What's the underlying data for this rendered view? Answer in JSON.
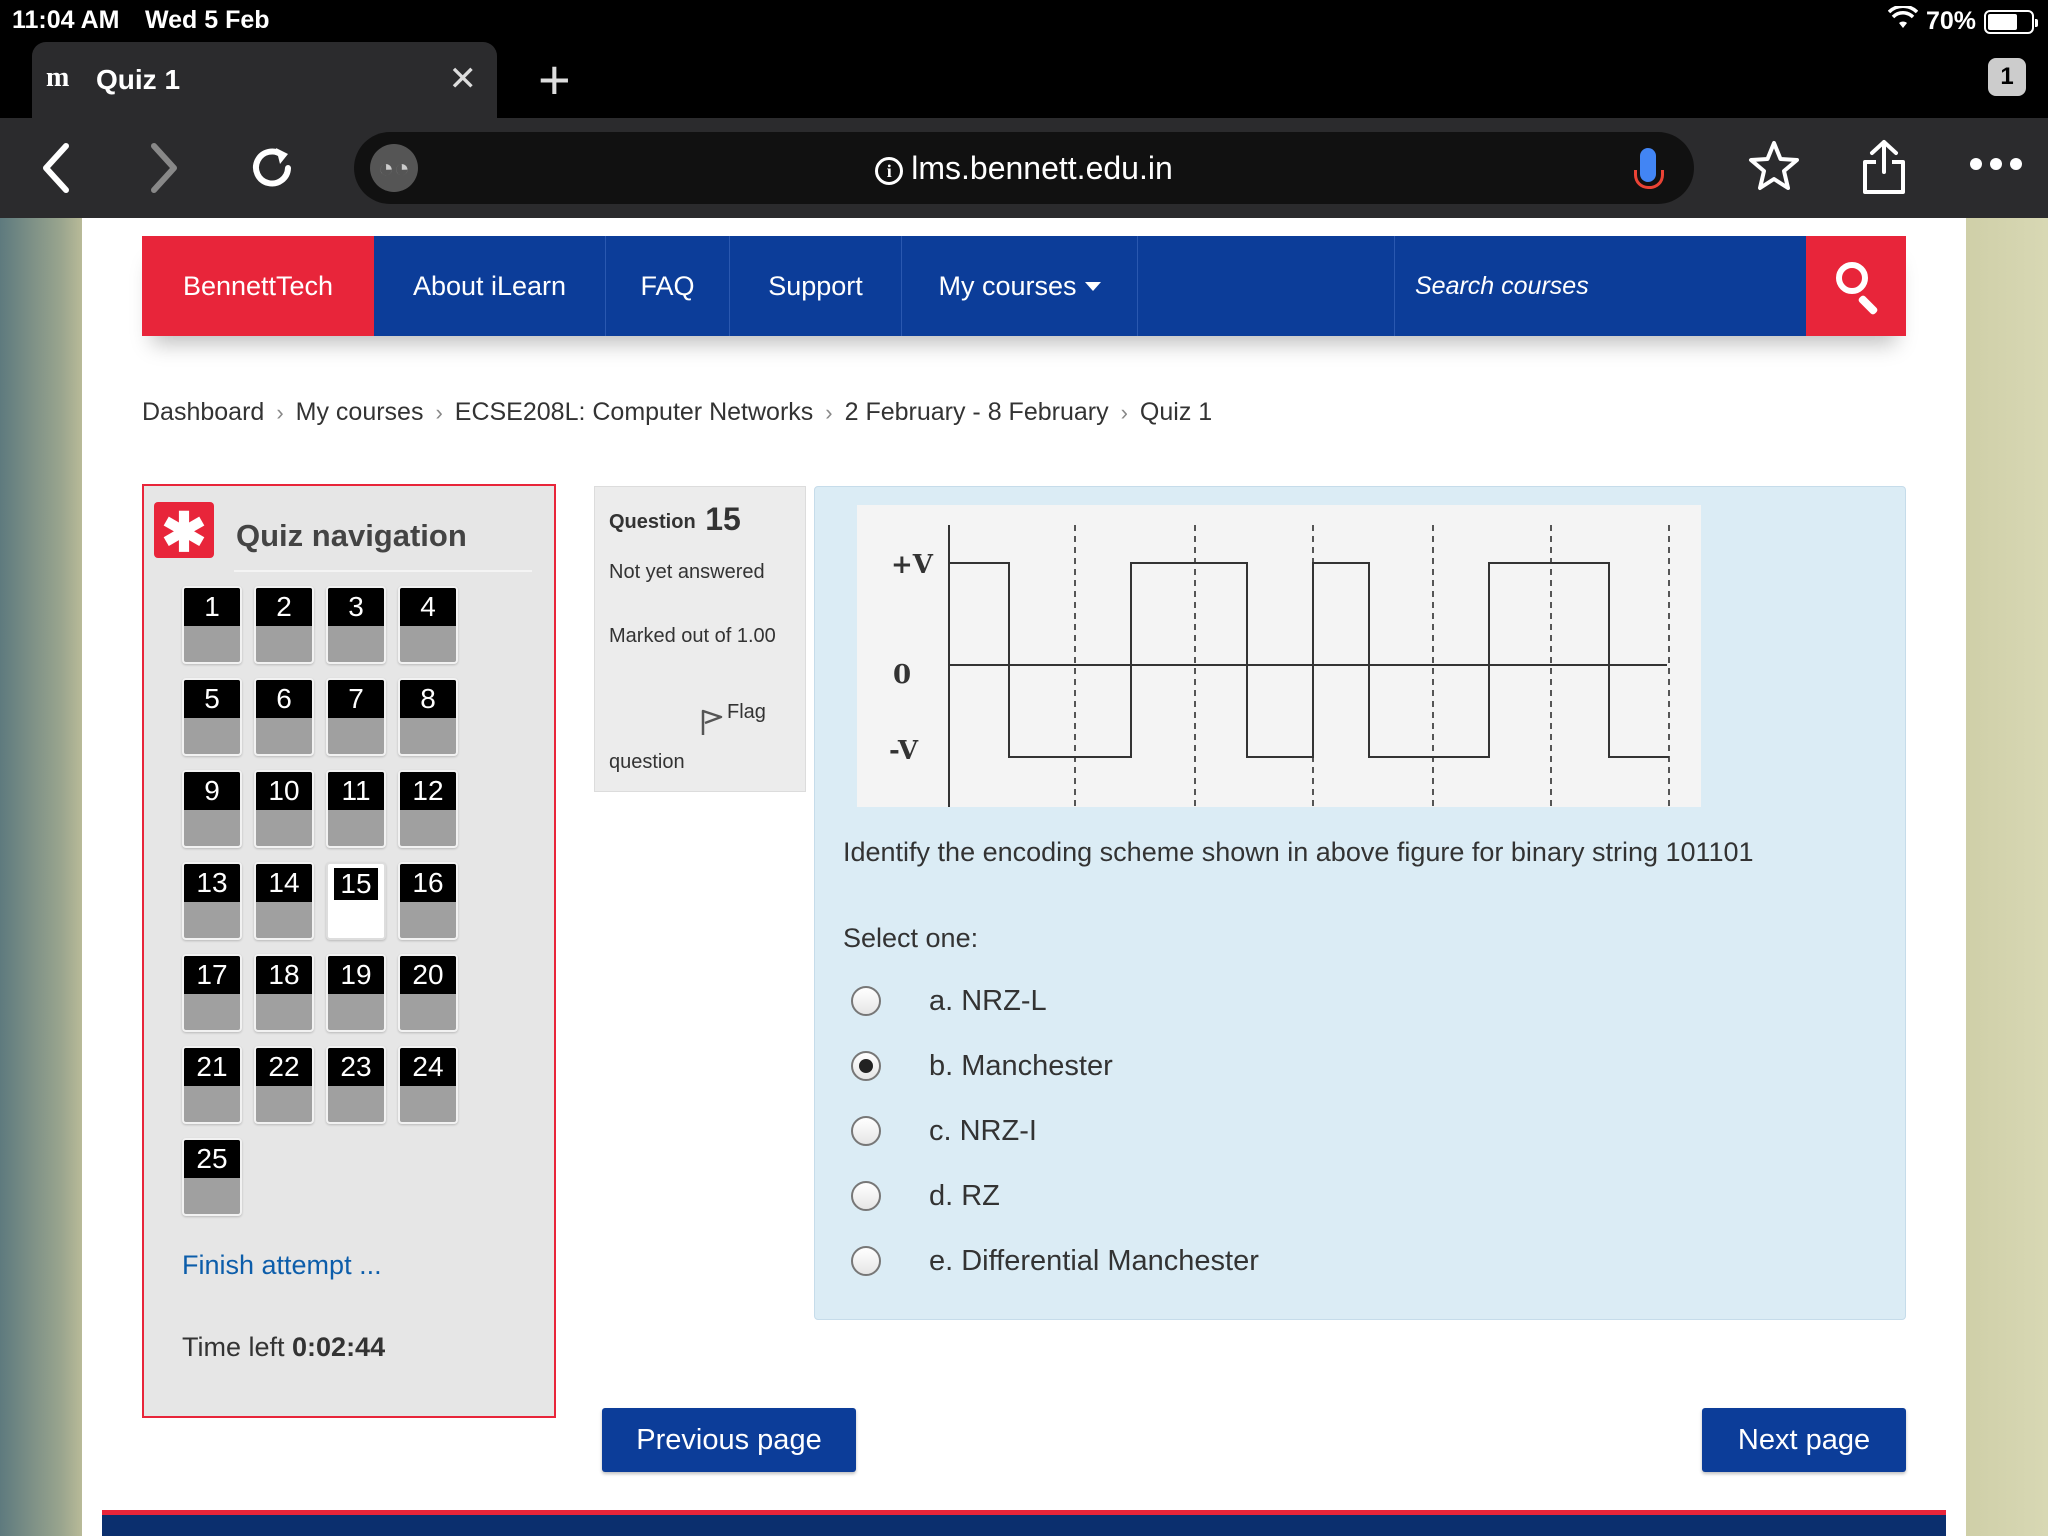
{
  "status": {
    "time": "11:04 AM",
    "date": "Wed 5 Feb",
    "battery": "70%"
  },
  "browser": {
    "tab_title": "Quiz 1",
    "tab_count": "1",
    "url": "lms.bennett.edu.in"
  },
  "nav": {
    "brand": "BennettTech",
    "items": [
      "About iLearn",
      "FAQ",
      "Support",
      "My courses"
    ],
    "search_placeholder": "Search courses"
  },
  "breadcrumb": [
    "Dashboard",
    "My courses",
    "ECSE208L: Computer Networks",
    "2 February - 8 February",
    "Quiz 1"
  ],
  "quiz_nav": {
    "title": "Quiz navigation",
    "questions": [
      "1",
      "2",
      "3",
      "4",
      "5",
      "6",
      "7",
      "8",
      "9",
      "10",
      "11",
      "12",
      "13",
      "14",
      "15",
      "16",
      "17",
      "18",
      "19",
      "20",
      "21",
      "22",
      "23",
      "24",
      "25"
    ],
    "current": "15",
    "finish_label": "Finish attempt ...",
    "time_label": "Time left",
    "time_value": "0:02:44"
  },
  "question_info": {
    "label": "Question",
    "number": "15",
    "state": "Not yet answered",
    "marks": "Marked out of 1.00",
    "flag_label": "Flag",
    "flag_label_2": "question"
  },
  "question": {
    "figure_labels": {
      "pos": "+V",
      "zero": "0",
      "neg": "-V"
    },
    "prompt": "Identify the encoding scheme shown in above figure for binary string 101101",
    "select_label": "Select one:",
    "options": [
      "a. NRZ-L",
      "b. Manchester",
      "c. NRZ-I",
      "d. RZ",
      "e. Differential Manchester"
    ],
    "selected": "b. Manchester"
  },
  "buttons": {
    "previous": "Previous page",
    "next": "Next page"
  }
}
